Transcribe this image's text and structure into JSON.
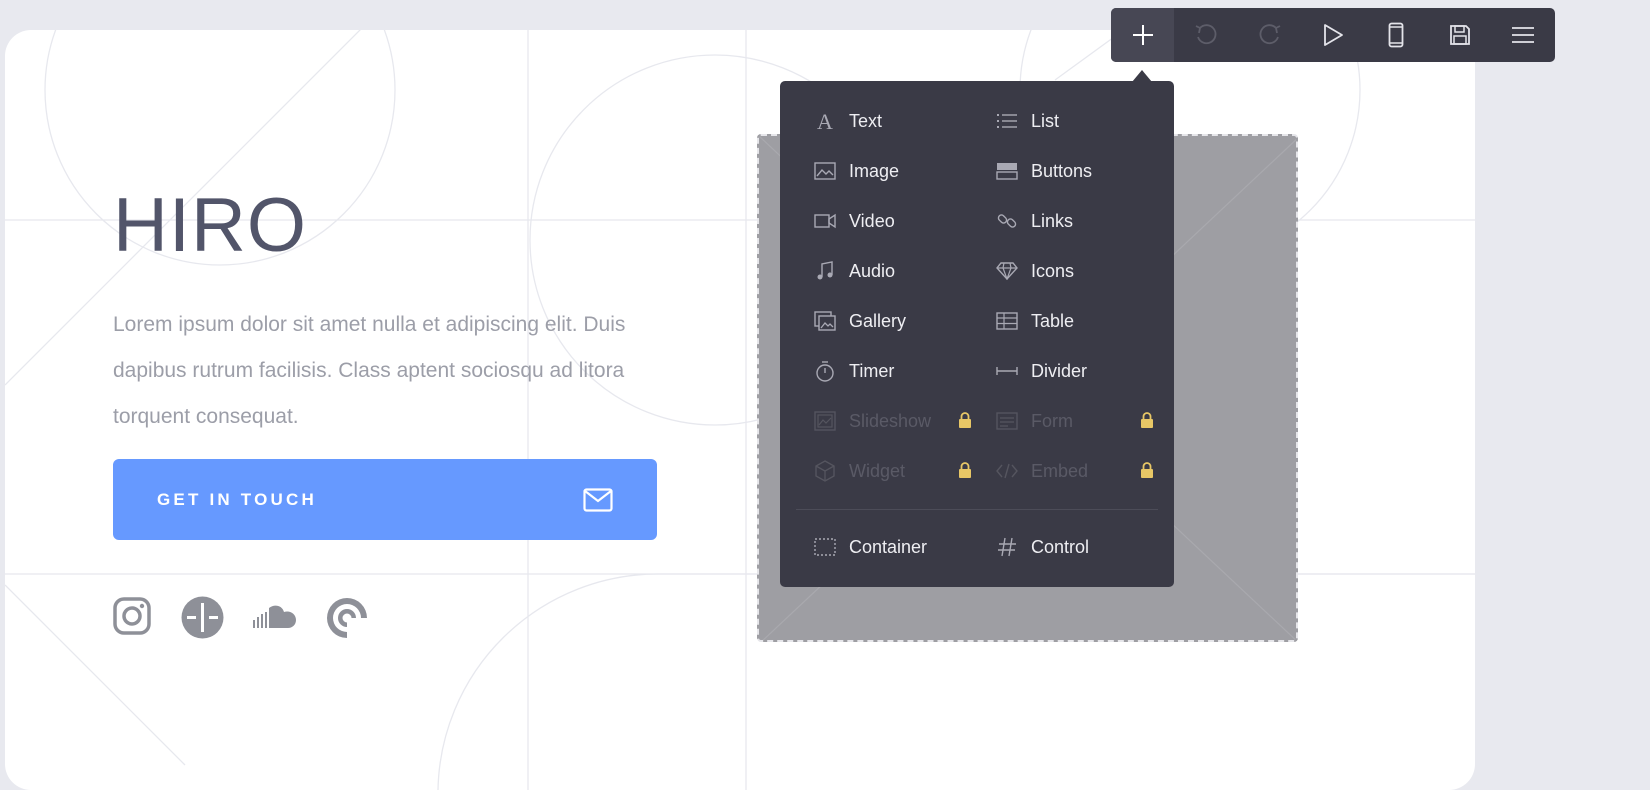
{
  "hero": {
    "title": "HIRO",
    "description": "Lorem ipsum dolor sit amet nulla et adipiscing elit. Duis dapibus rutrum facilisis. Class aptent sociosqu ad litora torquent consequat.",
    "cta_label": "GET IN TOUCH"
  },
  "social_icons": [
    "instagram-icon",
    "product-hunt-icon",
    "soundcloud-icon",
    "pocketcasts-icon"
  ],
  "toolbar": {
    "buttons": [
      "add-icon",
      "undo-icon",
      "redo-icon",
      "play-icon",
      "mobile-icon",
      "save-icon",
      "menu-icon"
    ]
  },
  "menu": {
    "text": "Text",
    "list": "List",
    "image": "Image",
    "buttons": "Buttons",
    "video": "Video",
    "links": "Links",
    "audio": "Audio",
    "icons": "Icons",
    "gallery": "Gallery",
    "table": "Table",
    "timer": "Timer",
    "divider": "Divider",
    "slideshow": "Slideshow",
    "form": "Form",
    "widget": "Widget",
    "embed": "Embed",
    "container": "Container",
    "control": "Control"
  },
  "colors": {
    "accent": "#6699ff",
    "toolbar_bg": "#3a3a46",
    "lock": "#e8c766",
    "title": "#52556a"
  }
}
